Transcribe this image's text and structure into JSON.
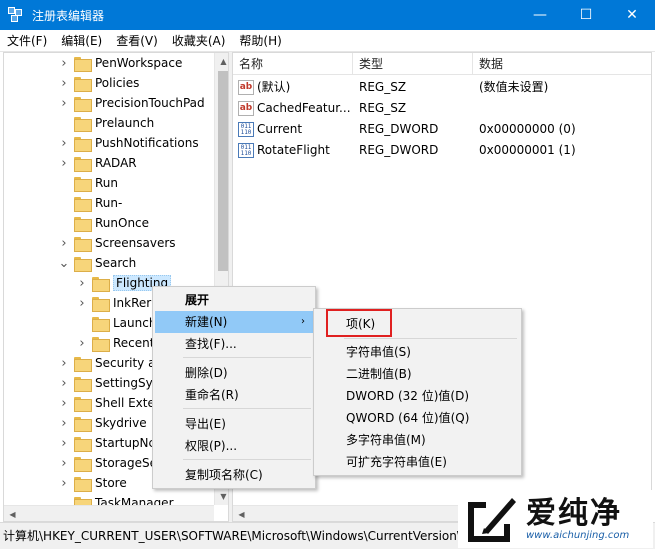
{
  "window": {
    "title": "注册表编辑器",
    "controls": {
      "minimize": "—",
      "maximize": "☐",
      "close": "✕"
    }
  },
  "menu": [
    "文件(F)",
    "编辑(E)",
    "查看(V)",
    "收藏夹(A)",
    "帮助(H)"
  ],
  "tree": [
    {
      "label": "PenWorkspace",
      "level": 1,
      "expander": "collapsed"
    },
    {
      "label": "Policies",
      "level": 1,
      "expander": "collapsed"
    },
    {
      "label": "PrecisionTouchPad",
      "level": 1,
      "expander": "collapsed"
    },
    {
      "label": "Prelaunch",
      "level": 1,
      "expander": "none"
    },
    {
      "label": "PushNotifications",
      "level": 1,
      "expander": "collapsed"
    },
    {
      "label": "RADAR",
      "level": 1,
      "expander": "collapsed"
    },
    {
      "label": "Run",
      "level": 1,
      "expander": "none"
    },
    {
      "label": "Run-",
      "level": 1,
      "expander": "none"
    },
    {
      "label": "RunOnce",
      "level": 1,
      "expander": "none"
    },
    {
      "label": "Screensavers",
      "level": 1,
      "expander": "collapsed"
    },
    {
      "label": "Search",
      "level": 1,
      "expander": "expanded"
    },
    {
      "label": "Flighting",
      "level": 2,
      "expander": "collapsed",
      "selected": true
    },
    {
      "label": "InkRer",
      "level": 2,
      "expander": "collapsed"
    },
    {
      "label": "Launch",
      "level": 2,
      "expander": "none"
    },
    {
      "label": "Recent",
      "level": 2,
      "expander": "collapsed"
    },
    {
      "label": "Security a",
      "level": 1,
      "expander": "collapsed"
    },
    {
      "label": "SettingSyr",
      "level": 1,
      "expander": "collapsed"
    },
    {
      "label": "Shell Exter",
      "level": 1,
      "expander": "collapsed"
    },
    {
      "label": "Skydrive",
      "level": 1,
      "expander": "collapsed"
    },
    {
      "label": "StartupNc",
      "level": 1,
      "expander": "collapsed"
    },
    {
      "label": "StorageSe",
      "level": 1,
      "expander": "collapsed"
    },
    {
      "label": "Store",
      "level": 1,
      "expander": "collapsed"
    },
    {
      "label": "TaskManager",
      "level": 1,
      "expander": "none"
    }
  ],
  "values": {
    "headers": {
      "name": "名称",
      "type": "类型",
      "data": "数据"
    },
    "rows": [
      {
        "icon": "ab-string-icon",
        "name": "(默认)",
        "type": "REG_SZ",
        "data": "(数值未设置)"
      },
      {
        "icon": "ab-string-icon",
        "name": "CachedFeatur...",
        "type": "REG_SZ",
        "data": ""
      },
      {
        "icon": "binary-dword-icon",
        "name": "Current",
        "type": "REG_DWORD",
        "data": "0x00000000 (0)"
      },
      {
        "icon": "binary-dword-icon",
        "name": "RotateFlight",
        "type": "REG_DWORD",
        "data": "0x00000001 (1)"
      }
    ]
  },
  "context_menu": {
    "items": [
      "展开",
      "新建(N)",
      "查找(F)...",
      "删除(D)",
      "重命名(R)",
      "导出(E)",
      "权限(P)...",
      "复制项名称(C)"
    ],
    "submenu_arrow": "›",
    "highlighted": "新建(N)"
  },
  "submenu": {
    "items": [
      "项(K)",
      "字符串值(S)",
      "二进制值(B)",
      "DWORD (32 位)值(D)",
      "QWORD (64 位)值(Q)",
      "多字符串值(M)",
      "可扩充字符串值(E)"
    ],
    "annotated": "项(K)",
    "annotation_color": "#e02020"
  },
  "status": "计算机\\HKEY_CURRENT_USER\\SOFTWARE\\Microsoft\\Windows\\CurrentVersion\\Search\\Flighting",
  "watermark": {
    "title": "爱纯净",
    "url": "www.aichunjing.com"
  },
  "colors": {
    "titlebar": "#0078d7",
    "menu_hover": "#91c9f7",
    "selection": "#cce8ff"
  }
}
